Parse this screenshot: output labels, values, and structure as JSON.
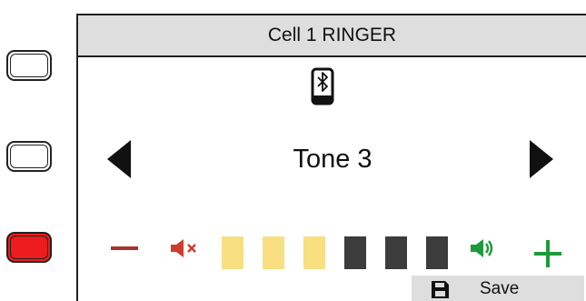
{
  "hardware_buttons": [
    {
      "name": "side-button-top",
      "color": "#ffffff"
    },
    {
      "name": "side-button-middle",
      "color": "#ffffff"
    },
    {
      "name": "side-button-bottom",
      "color": "#ee1c1c"
    }
  ],
  "screen": {
    "title": "Cell 1 RINGER",
    "device_icon": "bluetooth-phone-icon",
    "tone_selector": {
      "value": "Tone 3",
      "prev_icon": "left-arrow-icon",
      "next_icon": "right-arrow-icon"
    },
    "volume": {
      "decrease_icon": "minus-icon",
      "mute_icon": "mute-speaker-icon",
      "unmute_icon": "speaker-icon",
      "increase_icon": "plus-icon",
      "level": 3,
      "max_level": 6,
      "segment_on_color": "#f7df82",
      "segment_off_color": "#3c3c3c",
      "minus_color": "#a8352b",
      "plus_color": "#1f9a3a"
    },
    "save_button": {
      "label": "Save",
      "icon": "floppy-disk-icon"
    }
  }
}
